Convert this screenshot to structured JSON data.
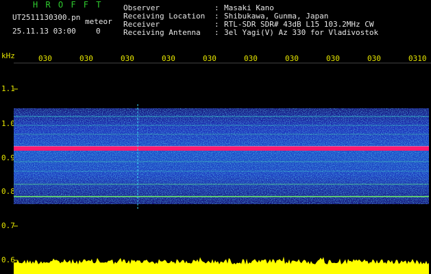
{
  "header": {
    "title": "H R O F F T",
    "filename": "UT2511130300.pn",
    "type": "meteor",
    "datetime": "25.11.13 03:00",
    "count": "0",
    "info": [
      {
        "key": "Observer",
        "value": "Masaki Kano"
      },
      {
        "key": "Receiving Location",
        "value": "Shibukawa, Gunma, Japan"
      },
      {
        "key": "Receiver",
        "value": "RTL-SDR SDR# 43dB L15 103.2MHz CW"
      },
      {
        "key": "Receiving Antenna",
        "value": "3el Yagi(V) Az 330 for Vladivostok"
      }
    ]
  },
  "axes": {
    "y_unit": "kHz",
    "y_ticks": [
      "1.1",
      "1.0",
      "0.9",
      "0.8",
      "0.7",
      "0.6"
    ],
    "x_ticks": [
      "030",
      "030",
      "030",
      "030",
      "030",
      "030",
      "030",
      "030",
      "030",
      "0310"
    ]
  },
  "colors": {
    "signal_line": "#ff1a6e",
    "amplitude": "#ffff00",
    "tick_text": "#e6e600",
    "header_text": "#e8e8e8",
    "title_green": "#2ecc2e",
    "noise_low": "#1a1ab0",
    "noise_mid": "#18b0d8",
    "noise_high": "#3cd890"
  }
}
